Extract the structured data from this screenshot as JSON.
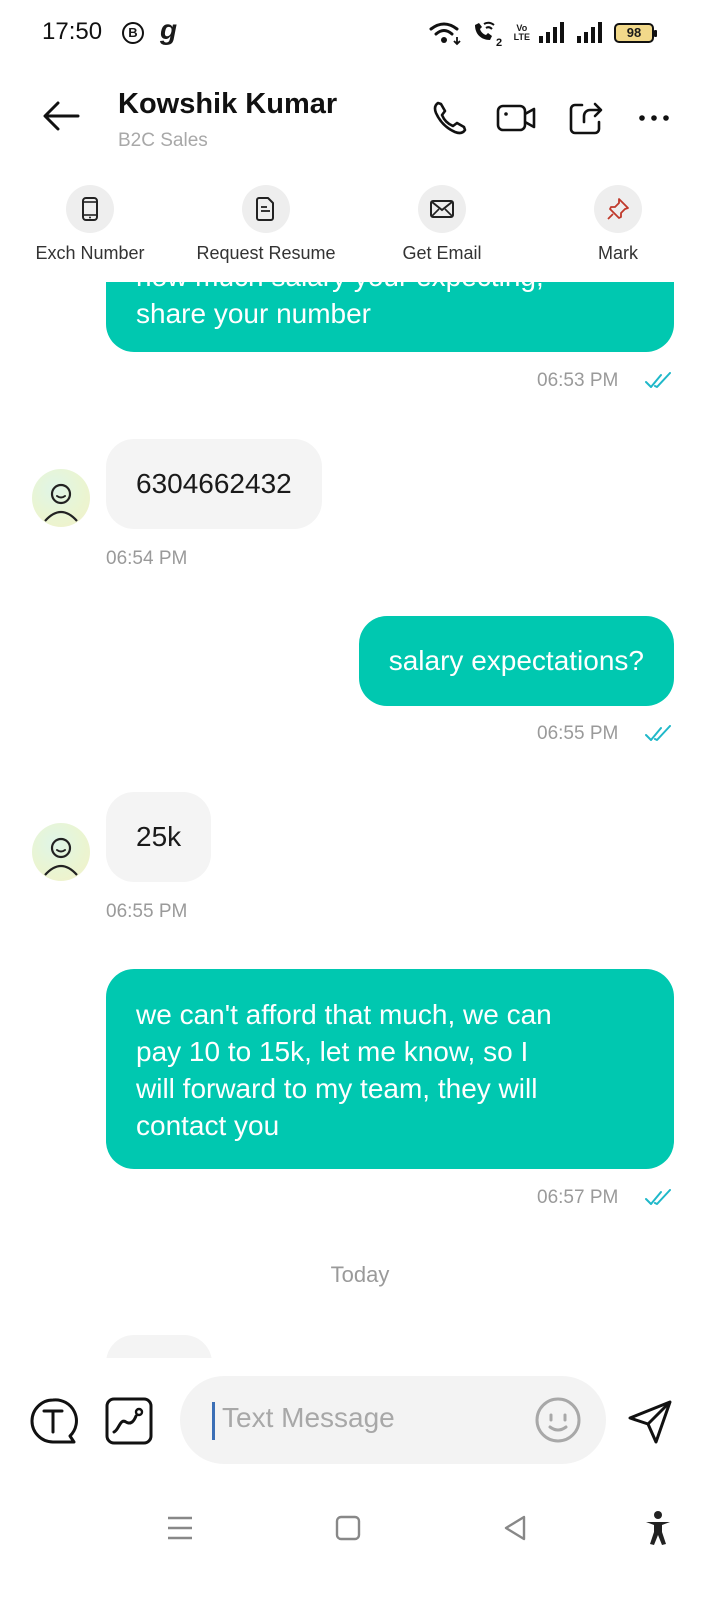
{
  "status_bar": {
    "time": "17:50",
    "b_badge": "B",
    "g_glyph": "g",
    "volte_top": "Vo",
    "volte_bottom": "LTE",
    "sim2_label": "2",
    "battery": "98"
  },
  "header": {
    "contact_name": "Kowshik Kumar",
    "contact_subtitle": "B2C Sales"
  },
  "quick_actions": [
    {
      "label": "Exch Number",
      "icon": "phone-device-icon"
    },
    {
      "label": "Request Resume",
      "icon": "document-icon"
    },
    {
      "label": "Get Email",
      "icon": "mail-icon"
    },
    {
      "label": "Mark",
      "icon": "pin-icon"
    }
  ],
  "messages": {
    "m1": {
      "direction": "out",
      "partial_line": "how much salary your expecting,",
      "text": "share your number",
      "time": "06:53 PM"
    },
    "m2": {
      "direction": "in",
      "text": "6304662432",
      "time": "06:54 PM"
    },
    "m3": {
      "direction": "out",
      "text": "salary expectations?",
      "time": "06:55 PM"
    },
    "m4": {
      "direction": "in",
      "text": "25k",
      "time": "06:55 PM"
    },
    "m5": {
      "direction": "out",
      "lines": [
        "we can't afford that much, we can",
        "pay 10 to 15k, let me know, so I",
        "will forward to my team, they will",
        "contact you"
      ],
      "time": "06:57 PM"
    }
  },
  "day_separator": "Today",
  "composer": {
    "placeholder": "Text Message"
  },
  "colors": {
    "outgoing_bubble": "#00c8b0",
    "incoming_bubble": "#f4f4f4",
    "read_ticks": "#1fb8c9",
    "timestamp": "#9a9a9a"
  }
}
